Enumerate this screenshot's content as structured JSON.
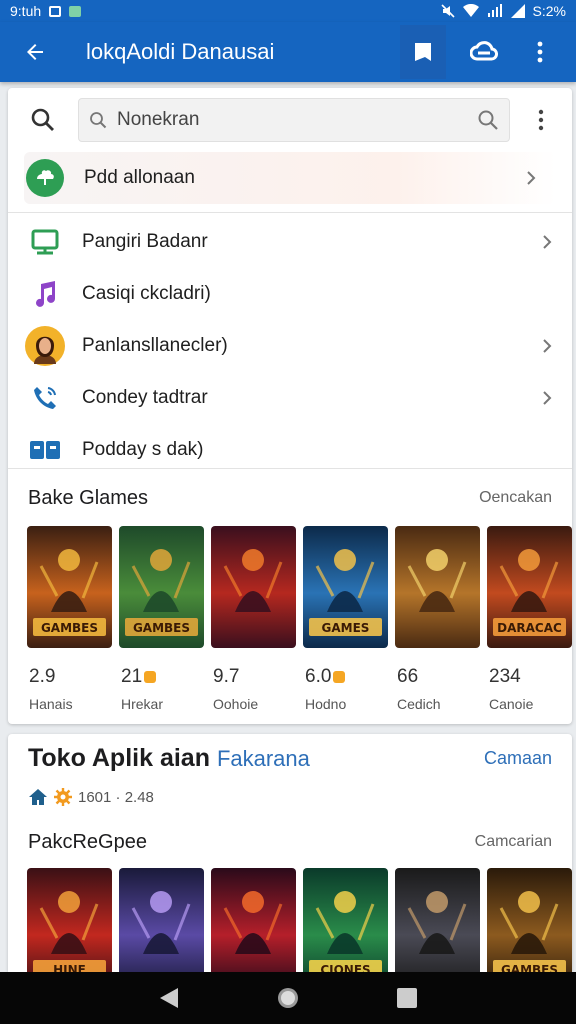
{
  "status_bar": {
    "time": "9:tuh",
    "battery": "S:2%"
  },
  "app_bar": {
    "title": "lokqAoldi Danausai"
  },
  "search": {
    "value": "Nonekran"
  },
  "menu": [
    {
      "label": "Pdd allonaan",
      "chevron": true
    },
    {
      "label": "Pangiri Badanr",
      "chevron": true
    },
    {
      "label": "Casiqi ckcladri)",
      "chevron": false
    },
    {
      "label": "Panlansllanecler)",
      "chevron": true
    },
    {
      "label": "Condey tadtrar",
      "chevron": true
    },
    {
      "label": "Podday s dak)",
      "chevron": false
    }
  ],
  "games_section": {
    "title": "Bake Glames",
    "link": "Oencakan",
    "games": [
      {
        "rating": "2.9",
        "badge": false,
        "name": "Hanais",
        "cover_text": "GAMBES",
        "colors": [
          "#3b1f12",
          "#c7621d",
          "#f1b73d"
        ]
      },
      {
        "rating": "21",
        "badge": true,
        "name": "Hrekar",
        "cover_text": "GAMBES",
        "colors": [
          "#1e4a2a",
          "#4a8c3a",
          "#e0a63a"
        ]
      },
      {
        "rating": "9.7",
        "badge": false,
        "name": "Oohoie",
        "cover_text": "",
        "colors": [
          "#3a0f1e",
          "#b5281f",
          "#f07a2a"
        ]
      },
      {
        "rating": "6.0",
        "badge": true,
        "name": "Hodno",
        "cover_text": "GAMES",
        "colors": [
          "#0c2a4a",
          "#2a73b5",
          "#f2c14a"
        ]
      },
      {
        "rating": "66",
        "badge": false,
        "name": "Cedich",
        "cover_text": "",
        "colors": [
          "#4a2a12",
          "#b5752a",
          "#f2d06a"
        ]
      },
      {
        "rating": "234",
        "badge": false,
        "name": "Canoie",
        "cover_text": "DARACAC",
        "colors": [
          "#3a1a10",
          "#c24a1f",
          "#f29a3a"
        ]
      }
    ]
  },
  "store": {
    "title": "Toko Aplik aian",
    "subtitle": "Fakarana",
    "link": "Camaan",
    "meta": "1601 · 2.48",
    "section_title": "PakcReGpee",
    "section_link": "Camcarian",
    "covers": [
      {
        "cover_text": "HINE",
        "colors": [
          "#3a1015",
          "#c2281f",
          "#f2a03a"
        ]
      },
      {
        "cover_text": "",
        "colors": [
          "#1a1a3a",
          "#5a4aa5",
          "#b59af2"
        ]
      },
      {
        "cover_text": "",
        "colors": [
          "#2a0a1a",
          "#b51f2a",
          "#f26a2a"
        ]
      },
      {
        "cover_text": "CIONES",
        "colors": [
          "#0a3a2a",
          "#2a8c4a",
          "#f2d04a"
        ]
      },
      {
        "cover_text": "",
        "colors": [
          "#1a1a1a",
          "#4a4a55",
          "#c29a6a"
        ]
      },
      {
        "cover_text": "GAMBES",
        "colors": [
          "#2a1a0a",
          "#8c5a1f",
          "#f2c04a"
        ]
      }
    ]
  },
  "colors": {
    "primary": "#1565c0",
    "link": "#2e6fb8"
  }
}
